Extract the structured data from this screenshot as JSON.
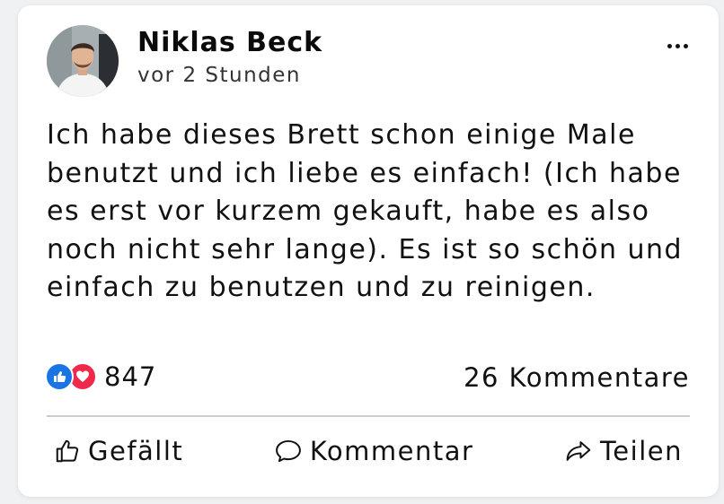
{
  "post": {
    "author": "Niklas Beck",
    "time": "vor 2 Stunden",
    "text": "Ich habe dieses Brett schon einige Male benutzt und ich liebe es einfach! (Ich habe es erst vor kurzem gekauft, habe es also noch nicht sehr lange). Es ist so schön und einfach zu benutzen und zu reinigen."
  },
  "reactions": {
    "count": "847",
    "types": [
      "like-icon",
      "love-icon"
    ],
    "colors": {
      "like": "#1b74e4",
      "love": "#f0284a"
    }
  },
  "comments": {
    "label": "26 Kommentare"
  },
  "actions": {
    "like_label": "Gefällt",
    "comment_label": "Kommentar",
    "share_label": "Teilen"
  }
}
